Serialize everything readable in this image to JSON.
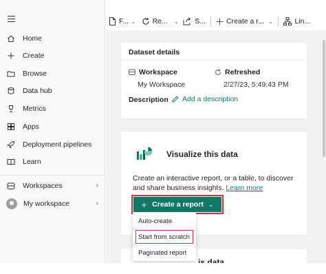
{
  "sidebar": {
    "items": [
      {
        "label": "Home",
        "icon": "home-icon"
      },
      {
        "label": "Create",
        "icon": "plus-icon"
      },
      {
        "label": "Browse",
        "icon": "folder-icon"
      },
      {
        "label": "Data hub",
        "icon": "database-icon"
      },
      {
        "label": "Metrics",
        "icon": "trophy-icon"
      },
      {
        "label": "Apps",
        "icon": "apps-icon"
      },
      {
        "label": "Deployment pipelines",
        "icon": "rocket-icon"
      },
      {
        "label": "Learn",
        "icon": "book-icon"
      }
    ],
    "workspaces_label": "Workspaces",
    "my_workspace_label": "My workspace"
  },
  "toolbar": {
    "file_label": "F...",
    "refresh_label": "Re...",
    "share_label": "S...",
    "create_report_label": "Create a r...",
    "lineage_label": "Lin..."
  },
  "details": {
    "title": "Dataset details",
    "workspace_label": "Workspace",
    "workspace_value": "My Workspace",
    "refreshed_label": "Refreshed",
    "refreshed_value": "2/27/23, 5:49:43 PM",
    "description_label": "Description",
    "add_description": "Add a description"
  },
  "visualize": {
    "title": "Visualize this data",
    "description": "Create an interactive report, or a table, to discover and share business insights.",
    "learn_more": "Learn more",
    "create_button": "Create a report",
    "menu": [
      "Auto-create",
      "Start from scratch",
      "Paginated report"
    ],
    "next_card_title": "is data"
  },
  "colors": {
    "accent": "#117865",
    "highlight": "#d13438"
  }
}
